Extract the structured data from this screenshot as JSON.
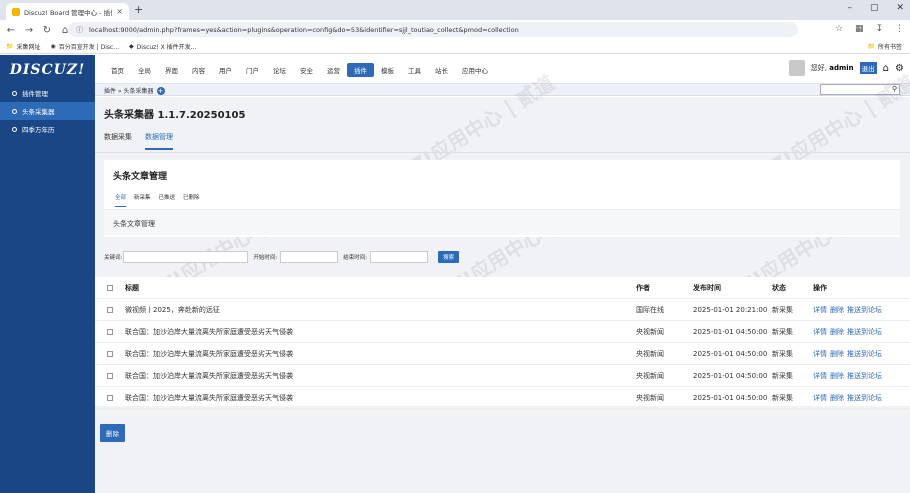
{
  "browser": {
    "tab_title": "Discuz! Board 管理中心 - 插件",
    "tab_close": "×",
    "new_tab": "+",
    "url": "localhost:9000/admin.php?frames=yes&action=plugins&operation=config&do=53&identifier=sjjl_toutiao_collect&pmod=collection",
    "bookmarks": [
      "采集网址",
      "百分百宣开发 | Disc...",
      "Discuz! X 插件开发..."
    ],
    "bookmarks_right": "所有书签",
    "win_min": "–",
    "win_max": "▢",
    "win_close": "✕"
  },
  "header": {
    "logo": "DISCUZ!",
    "menu": [
      "首页",
      "全局",
      "界面",
      "内容",
      "用户",
      "门户",
      "论坛",
      "安全",
      "运营",
      "插件",
      "模板",
      "工具",
      "站长",
      "应用中心"
    ],
    "active_menu": "插件",
    "greeting": "您好,",
    "username": "admin",
    "logout": "退出"
  },
  "sidebar": {
    "items": [
      {
        "label": "插件管理"
      },
      {
        "label": "头条采集器"
      },
      {
        "label": "四季万年历"
      }
    ]
  },
  "breadcrumb": {
    "path": "插件 » 头条采集器",
    "plus": "+"
  },
  "page": {
    "title": "头条采集器 1.1.7.20250105",
    "tabs": [
      "数据采集",
      "数据管理"
    ]
  },
  "card": {
    "title": "头条文章管理",
    "tabs": [
      "全部",
      "新采集",
      "已推送",
      "已删除"
    ],
    "subtitle": "头条文章管理"
  },
  "filters": {
    "keyword_label": "关键词:",
    "start_label": "开始时间:",
    "end_label": "结束时间:",
    "search_button": "搜索"
  },
  "table": {
    "headers": {
      "title": "标题",
      "author": "作者",
      "time": "发布时间",
      "status": "状态",
      "ops": "操作"
    },
    "rows": [
      {
        "title": "微视频丨2025，奔赴新的远征",
        "author": "国际在线",
        "time": "2025-01-01 20:21:00",
        "status": "新采集"
      },
      {
        "title": "联合国：加沙泊岸大量流离失所家庭遭受恶劣天气侵袭",
        "author": "央视新闻",
        "time": "2025-01-01 04:50:00",
        "status": "新采集"
      },
      {
        "title": "联合国：加沙泊岸大量流离失所家庭遭受恶劣天气侵袭",
        "author": "央视新闻",
        "time": "2025-01-01 04:50:00",
        "status": "新采集"
      },
      {
        "title": "联合国：加沙泊岸大量流离失所家庭遭受恶劣天气侵袭",
        "author": "央视新闻",
        "time": "2025-01-01 04:50:00",
        "status": "新采集"
      },
      {
        "title": "联合国：加沙泊岸大量流离失所家庭遭受恶劣天气侵袭",
        "author": "央视新闻",
        "time": "2025-01-01 04:50:00",
        "status": "新采集"
      }
    ],
    "op_detail": "详情",
    "op_delete": "删除",
    "op_push": "推送到论坛"
  },
  "delete_button": "删除",
  "colors": {
    "brand": "#1b4685",
    "accent": "#2d6bb8"
  }
}
